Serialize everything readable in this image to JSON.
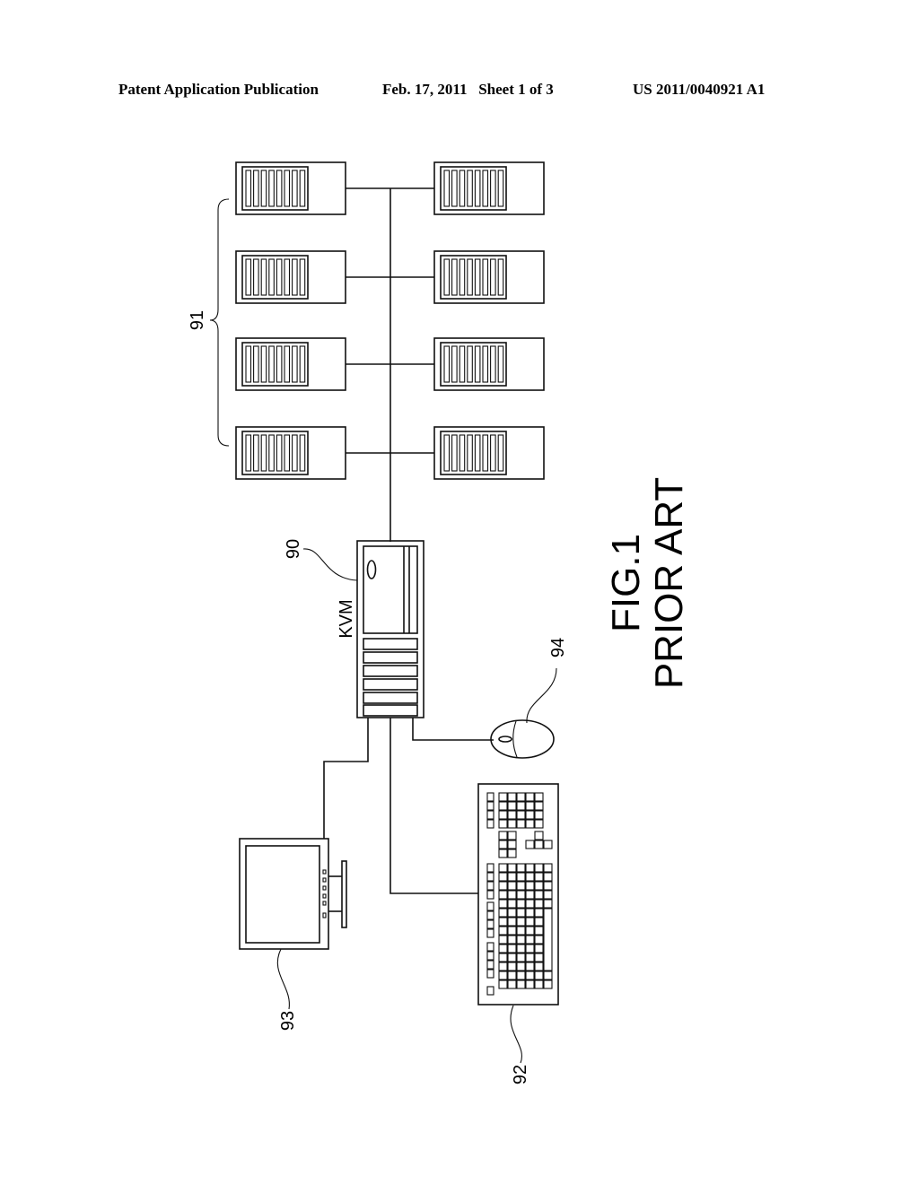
{
  "header": {
    "publication": "Patent Application Publication",
    "date_sheet": "Feb. 17, 2011   Sheet 1 of 3",
    "number": "US 2011/0040921 A1"
  },
  "figure": {
    "title": "FIG.1",
    "subtitle": "PRIOR ART",
    "kvm_label": "KVM",
    "refs": {
      "servers": "91",
      "kvm": "90",
      "keyboard": "92",
      "monitor": "93",
      "mouse": "94"
    }
  }
}
